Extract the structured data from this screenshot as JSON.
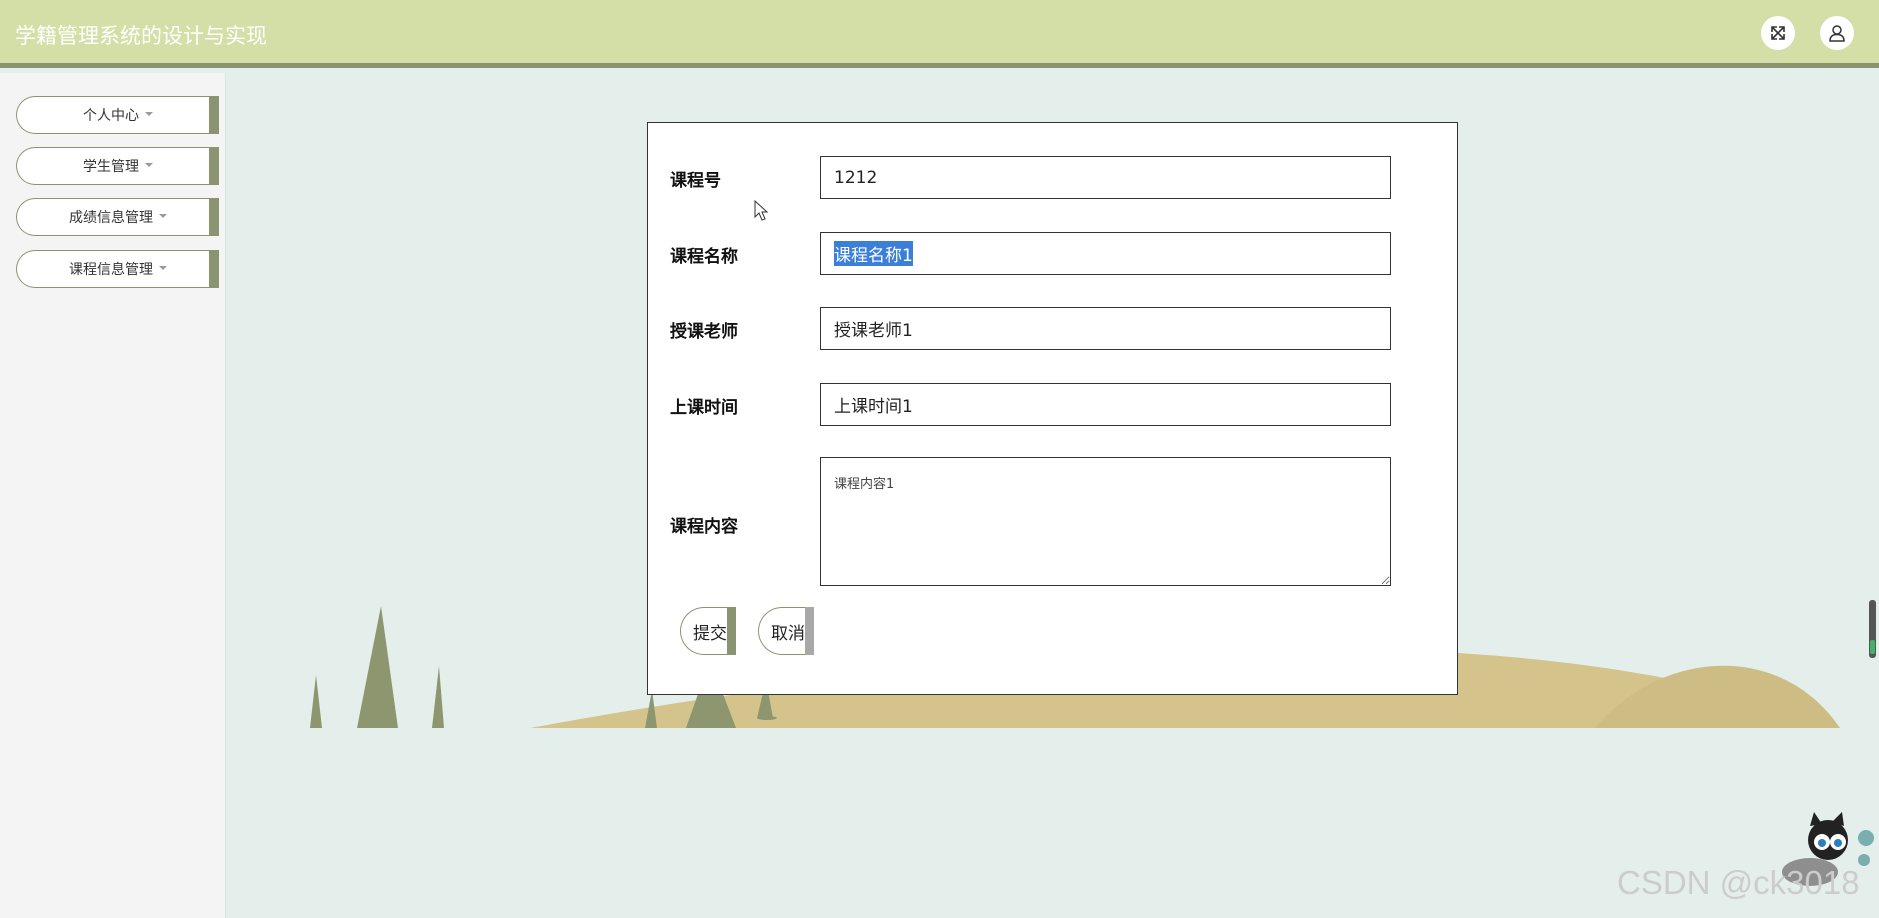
{
  "header": {
    "title": "学籍管理系统的设计与实现",
    "fullscreen_icon": "expand-arrows-icon",
    "user_icon": "user-icon"
  },
  "sidebar": {
    "items": [
      {
        "label": "个人中心"
      },
      {
        "label": "学生管理"
      },
      {
        "label": "成绩信息管理"
      },
      {
        "label": "课程信息管理"
      }
    ]
  },
  "form": {
    "fields": [
      {
        "label": "课程号",
        "value": "1212"
      },
      {
        "label": "课程名称",
        "value": "课程名称1"
      },
      {
        "label": "授课老师",
        "value": "授课老师1"
      },
      {
        "label": "上课时间",
        "value": "上课时间1"
      },
      {
        "label": "课程内容",
        "value": "课程内容1"
      }
    ],
    "submit_label": "提交",
    "cancel_label": "取消"
  },
  "watermark": "CSDN @ck3018",
  "colors": {
    "header_bg": "#d4dfa8",
    "accent": "#8b9470",
    "content_bg": "#e4efec",
    "hill": "#d4c48c",
    "tree": "#8e9670",
    "selection": "#3b7fd9"
  }
}
